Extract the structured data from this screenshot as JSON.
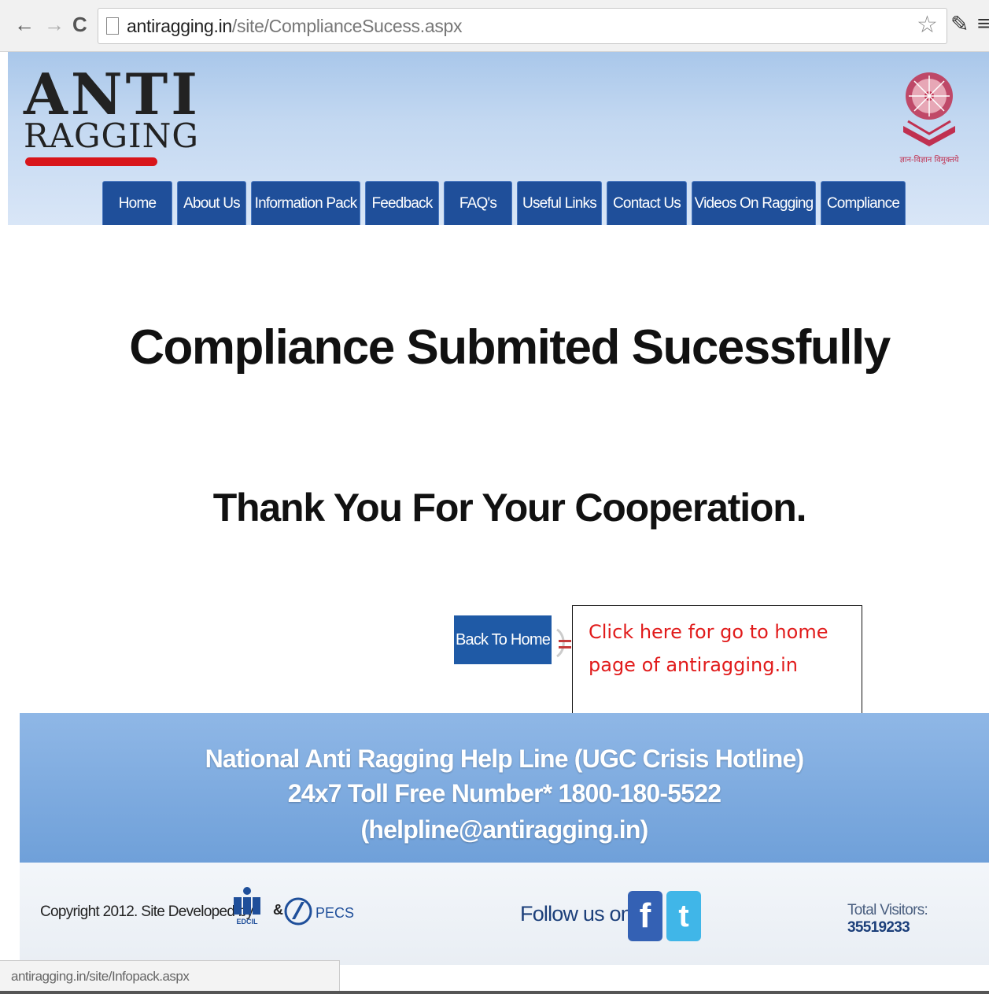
{
  "browser": {
    "url_host": "antiragging.in",
    "url_path": "/site/ComplianceSucess.aspx",
    "status_url": "antiragging.in/site/Infopack.aspx"
  },
  "header": {
    "logo_line1": "ANTI",
    "logo_line2": "RAGGING",
    "ugc_motto": "ज्ञान-विज्ञान विमुक्तये"
  },
  "nav": {
    "items": [
      {
        "label": "Home"
      },
      {
        "label": "About Us"
      },
      {
        "label": "Information Pack"
      },
      {
        "label": "Feedback"
      },
      {
        "label": "FAQ's"
      },
      {
        "label": "Useful Links"
      },
      {
        "label": "Contact Us"
      },
      {
        "label": "Videos On Ragging"
      },
      {
        "label": "Compliance"
      }
    ]
  },
  "main": {
    "title": "Compliance Submited Sucessfully",
    "thanks": "Thank You For Your Cooperation.",
    "back_button": "Back To Home"
  },
  "callout": {
    "text": "Click here for go to home page of antiragging.in"
  },
  "helpline": {
    "line1": "National Anti Ragging Help Line (UGC Crisis Hotline)",
    "line2": "24x7 Toll Free Number* 1800-180-5522",
    "line3": "(helpline@antiragging.in)"
  },
  "footer": {
    "copyright": "Copyright 2012. Site Developed by",
    "amp": "&",
    "pecs": "PECS",
    "edcil": "EDCIL",
    "follow_us": "Follow us on",
    "visitors_label": "Total Visitors:",
    "visitors_count": "35519233"
  },
  "colors": {
    "nav_bg": "#1f4f9a",
    "callout_text": "#e11b1b",
    "footer_band": "#7aa9de",
    "logo_red": "#d8151b"
  },
  "icons": [
    "back-icon",
    "forward-icon",
    "reload-icon",
    "page-icon",
    "star-icon",
    "tools-icon",
    "menu-icon",
    "facebook-icon",
    "twitter-icon"
  ]
}
